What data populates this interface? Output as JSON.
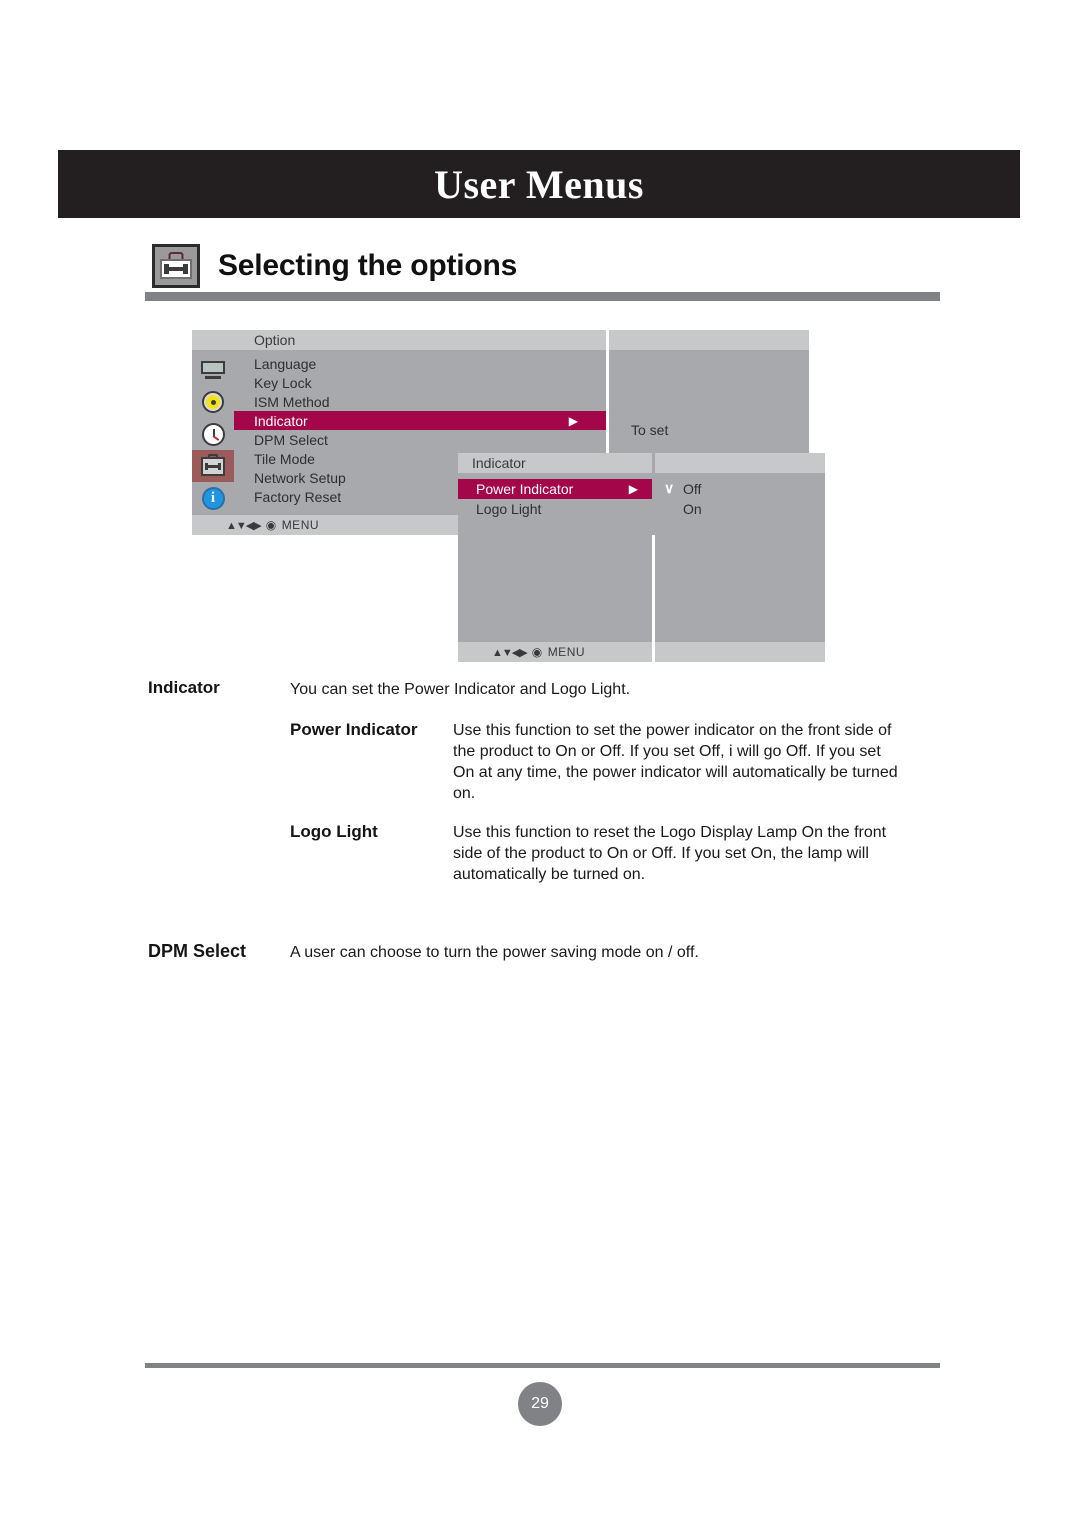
{
  "header": {
    "title": "User Menus"
  },
  "section": {
    "icon": "toolbox-icon",
    "title": "Selecting the options"
  },
  "osd_option": {
    "title": "Option",
    "rail_icons": [
      "monitor-icon",
      "picture-color-icon",
      "clock-icon",
      "toolbox-icon",
      "info-icon"
    ],
    "items": [
      {
        "label": "Language",
        "selected": false
      },
      {
        "label": "Key Lock",
        "selected": false
      },
      {
        "label": "ISM Method",
        "selected": false
      },
      {
        "label": "Indicator",
        "selected": true,
        "arrow": "▶"
      },
      {
        "label": "DPM Select",
        "selected": false
      },
      {
        "label": "Tile Mode",
        "selected": false
      },
      {
        "label": "Network Setup",
        "selected": false
      },
      {
        "label": "Factory Reset",
        "selected": false
      }
    ],
    "preview_text": "To set",
    "navbar": {
      "arrows": "▲▼◀▶",
      "dot": "◉",
      "label": "MENU"
    }
  },
  "osd_indicator": {
    "title": "Indicator",
    "items": [
      {
        "label": "Power Indicator",
        "selected": true,
        "arrow": "▶"
      },
      {
        "label": "Logo Light",
        "selected": false
      }
    ],
    "options": [
      {
        "label": "Off",
        "checked": true,
        "check_glyph": "∨"
      },
      {
        "label": "On",
        "checked": false,
        "check_glyph": ""
      }
    ],
    "navbar": {
      "arrows": "▲▼◀▶",
      "dot": "◉",
      "label": "MENU"
    }
  },
  "content": {
    "indicator_term": "Indicator",
    "indicator_desc": "You can set the Power Indicator and Logo Light.",
    "power_term": "Power Indicator",
    "power_desc": "Use this function to set the power indicator on the front side of the product to On or Off. If you set Off, i will go Off. If you set On at any time, the power indicator will automatically be turned on.",
    "logo_term": "Logo Light",
    "logo_desc": "Use this function to reset the Logo Display Lamp On the front side of the product to On or Off. If you set On, the lamp will automatically be turned on.",
    "dpm_term": "DPM Select",
    "dpm_desc": "A user can choose to turn the power saving mode on / off."
  },
  "footer": {
    "page_number": "29"
  },
  "colors": {
    "header_bg": "#231f20",
    "rule": "#808285",
    "osd_panel": "#a7a9ac",
    "osd_titlebar": "#c6c8ca",
    "osd_highlight": "#a4064a",
    "rail_active": "#9c5b5b"
  }
}
